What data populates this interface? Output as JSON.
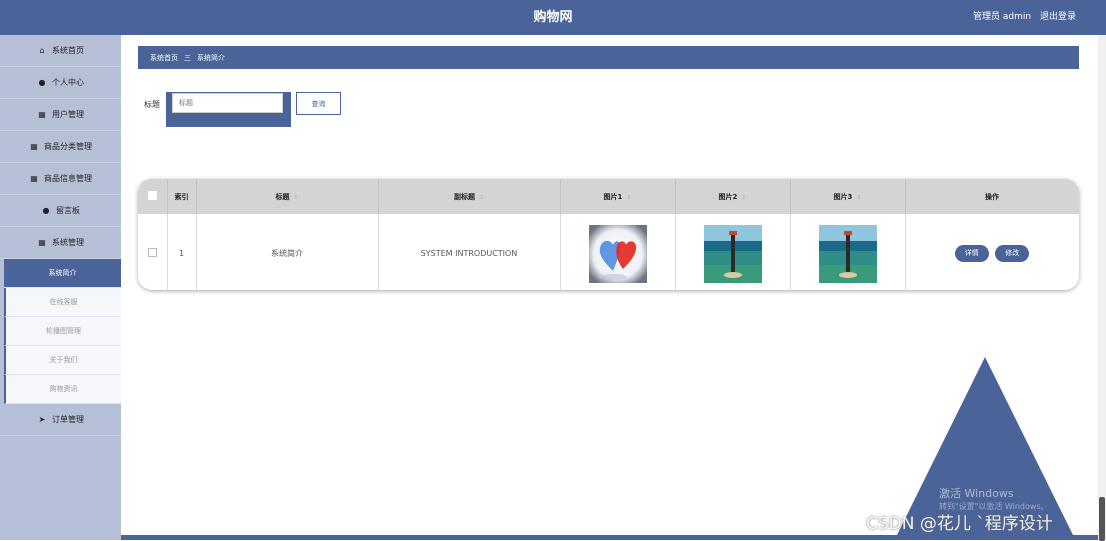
{
  "header": {
    "title": "购物网",
    "user": "管理员 admin",
    "logout": "退出登录"
  },
  "sidebar": {
    "items": [
      {
        "label": "系统首页",
        "icon": "home-icon",
        "glyph": "⌂"
      },
      {
        "label": "个人中心",
        "icon": "user-icon",
        "glyph": "●"
      },
      {
        "label": "用户管理",
        "icon": "grid-icon",
        "glyph": "▦"
      },
      {
        "label": "商品分类管理",
        "icon": "grid-icon",
        "glyph": "▦"
      },
      {
        "label": "商品信息管理",
        "icon": "grid-icon",
        "glyph": "▦"
      },
      {
        "label": "留言板",
        "icon": "user-icon",
        "glyph": "●"
      },
      {
        "label": "系统管理",
        "icon": "grid-icon",
        "glyph": "▦"
      }
    ],
    "sub_items": [
      "系统简介",
      "在线客服",
      "轮播图管理",
      "关于我们",
      "购物资讯"
    ],
    "active_sub": "系统简介",
    "order": {
      "label": "订单管理",
      "icon": "send-icon",
      "glyph": "➤"
    }
  },
  "breadcrumb": {
    "home": "系统首页",
    "sep": "三",
    "current": "系统简介"
  },
  "search": {
    "label": "标题",
    "placeholder": "标题",
    "button": "查询"
  },
  "table": {
    "columns": [
      "索引",
      "标题",
      "副标题",
      "图片1",
      "图片2",
      "图片3",
      "操作"
    ],
    "rows": [
      {
        "index": "1",
        "title": "系统简介",
        "subtitle": "SYSTEM INTRODUCTION",
        "images": [
          "hearts-image",
          "lighthouse-image",
          "lighthouse-image"
        ],
        "actions": [
          "详情",
          "修改"
        ]
      }
    ]
  },
  "watermarks": {
    "windows_line1": "激活 Windows",
    "windows_line2": "转到\"设置\"以激活 Windows。",
    "csdn": "CSDN @花儿 `程序设计"
  },
  "colors": {
    "primary": "#4a6399",
    "sidebar": "#b5c0d6",
    "header_row": "#d4d4d4"
  }
}
